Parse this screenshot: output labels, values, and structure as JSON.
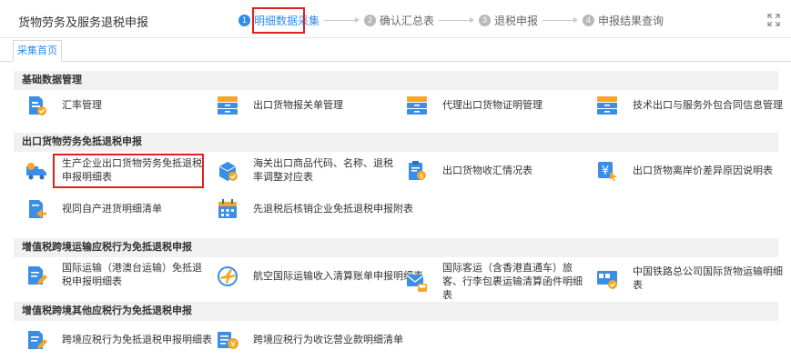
{
  "header": {
    "title": "货物劳务及服务退税申报",
    "steps": [
      {
        "num": "1",
        "label": "明细数据采集"
      },
      {
        "num": "2",
        "label": "确认汇总表"
      },
      {
        "num": "3",
        "label": "退税申报"
      },
      {
        "num": "4",
        "label": "申报结果查询"
      }
    ],
    "fullscreen_icon": "expand-icon"
  },
  "tabs": [
    {
      "label": "采集首页"
    }
  ],
  "colors": {
    "accent": "#2f8bea",
    "highlight": "#e02020",
    "icon_blue": "#3a8ee6",
    "icon_orange": "#f5a623"
  },
  "sections": [
    {
      "title": "基础数据管理",
      "items": [
        {
          "label": "汇率管理",
          "icon": "document-check-icon"
        },
        {
          "label": "出口货物报关单管理",
          "icon": "cabinet-icon"
        },
        {
          "label": "代理出口货物证明管理",
          "icon": "cabinet-icon"
        },
        {
          "label": "技术出口与服务外包合同信息管理",
          "icon": "cabinet-icon"
        }
      ]
    },
    {
      "title": "出口货物劳务免抵退税申报",
      "items": [
        {
          "label": "生产企业出口货物劳务免抵退税申报明细表",
          "icon": "truck-icon"
        },
        {
          "label": "海关出口商品代码、名称、退税率调整对应表",
          "icon": "box-check-icon"
        },
        {
          "label": "出口货物收汇情况表",
          "icon": "clipboard-currency-icon"
        },
        {
          "label": "出口货物离岸价差异原因说明表",
          "icon": "yen-cursor-icon"
        },
        {
          "label": "视同自产进货明细清单",
          "icon": "document-arrow-icon"
        },
        {
          "label": "先退税后核销企业免抵退税申报附表",
          "icon": "calendar-icon"
        }
      ]
    },
    {
      "title": "增值税跨境运输应税行为免抵退税申报",
      "items": [
        {
          "label": "国际运输（港澳台运输）免抵退税申报明细表",
          "icon": "document-edit-icon"
        },
        {
          "label": "航空国际运输收入清算账单申报明细表",
          "icon": "airplane-icon"
        },
        {
          "label": "国际客运（含香港直通车）旅客、行李包裹运输清算函件明细表",
          "icon": "mail-bus-icon"
        },
        {
          "label": "中国铁路总公司国际货物运输明细表",
          "icon": "train-box-icon"
        }
      ]
    },
    {
      "title": "增值税跨境其他应税行为免抵退税申报",
      "items": [
        {
          "label": "跨境应税行为免抵退税申报明细表",
          "icon": "document-edit-icon"
        },
        {
          "label": "跨境应税行为收讫营业款明细清单",
          "icon": "list-yen-icon"
        }
      ]
    }
  ]
}
